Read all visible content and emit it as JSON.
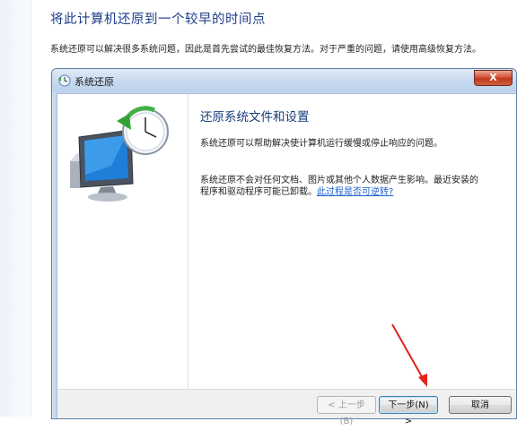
{
  "panel": {
    "title": "将此计算机还原到一个较早的时间点",
    "description": "系统还原可以解决很多系统问题，因此是首先尝试的最佳恢复方法。对于严重的问题，请使用高级恢复方法。"
  },
  "dialog": {
    "title": "系统还原",
    "close_label": "X",
    "heading": "还原系统文件和设置",
    "paragraph1": "系统还原可以帮助解决使计算机运行缓慢或停止响应的问题。",
    "paragraph2": "系统还原不会对任何文档、图片或其他个人数据产生影响。最近安装的程序和驱动程序可能已卸载。",
    "link_text": "此过程是否可逆转?",
    "buttons": {
      "back": "< 上一步(B)",
      "next": "下一步(N) >",
      "cancel": "取消"
    }
  },
  "annotation": {
    "arrow_color": "#e2231a"
  }
}
